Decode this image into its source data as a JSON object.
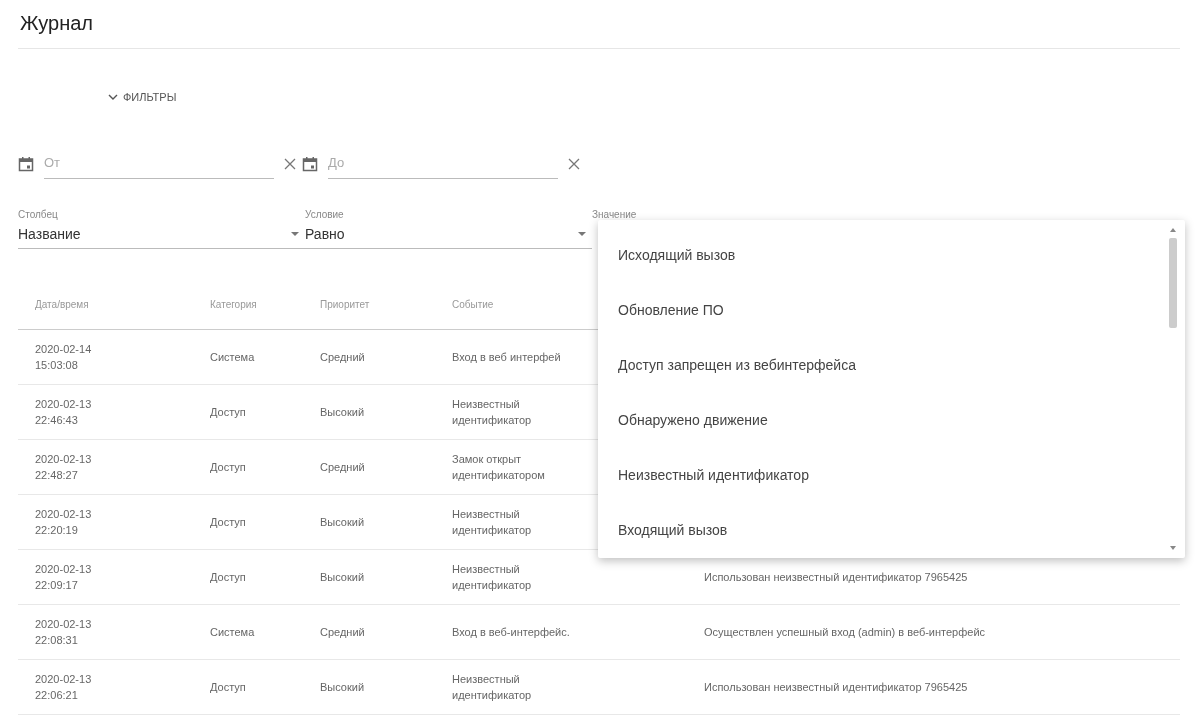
{
  "page": {
    "title": "Журнал"
  },
  "filters_toggle": {
    "label": "ФИЛЬТРЫ",
    "expanded": true
  },
  "date_range": [
    {
      "placeholder": "От"
    },
    {
      "placeholder": "До"
    }
  ],
  "selects": [
    {
      "label": "Столбец",
      "value": "Название"
    },
    {
      "label": "Условие",
      "value": "Равно"
    },
    {
      "label": "Значение"
    }
  ],
  "dropdown": {
    "items": [
      "Исходящий вызов",
      "Обновление ПО",
      "Доступ запрещен из вебинтерфейса",
      "Обнаружено движение",
      "Неизвестный идентификатор",
      "Входящий вызов"
    ]
  },
  "table": {
    "columns": [
      "Дата/время",
      "Категория",
      "Приоритет",
      "Событие"
    ],
    "rows": [
      {
        "datetime": "2020-02-14 15:03:08",
        "category": "Система",
        "priority": "Средний",
        "event": "Вход в веб интерфей"
      },
      {
        "datetime": "2020-02-13 22:46:43",
        "category": "Доступ",
        "priority": "Высокий",
        "event": "Неизвестный идентификатор"
      },
      {
        "datetime": "2020-02-13 22:48:27",
        "category": "Доступ",
        "priority": "Средний",
        "event": "Замок открыт идентификатором"
      },
      {
        "datetime": "2020-02-13 22:20:19",
        "category": "Доступ",
        "priority": "Высокий",
        "event": "Неизвестный идентификатор"
      },
      {
        "datetime": "2020-02-13 22:09:17",
        "category": "Доступ",
        "priority": "Высокий",
        "event": "Неизвестный идентификатор",
        "description": "Использован неизвестный идентификатор 7965425"
      },
      {
        "datetime": "2020-02-13 22:08:31",
        "category": "Система",
        "priority": "Средний",
        "event": "Вход в веб-интерфейс.",
        "description": "Осуществлен успешный вход (admin) в веб-интерфейс"
      },
      {
        "datetime": "2020-02-13 22:06:21",
        "category": "Доступ",
        "priority": "Высокий",
        "event": "Неизвестный идентификатор",
        "description": "Использован неизвестный идентификатор 7965425"
      }
    ]
  }
}
